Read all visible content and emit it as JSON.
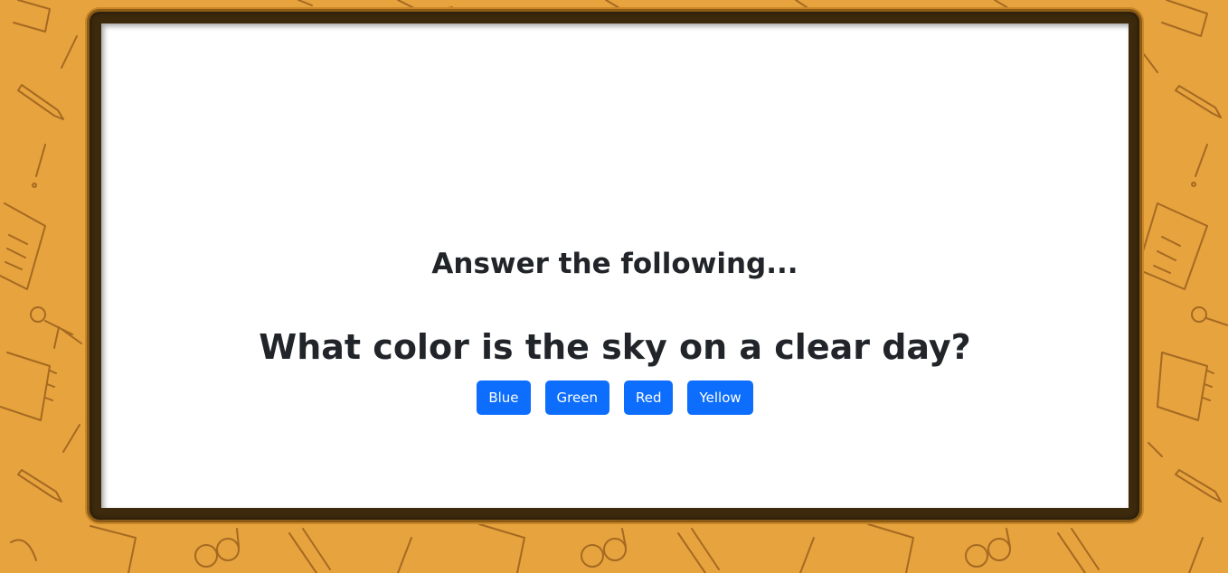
{
  "quiz": {
    "heading": "Answer the following...",
    "question": "What color is the sky on a clear day?",
    "answers": [
      "Blue",
      "Green",
      "Red",
      "Yellow"
    ]
  },
  "colors": {
    "background": "#e6a33e",
    "frame": "#3d2a0d",
    "board": "#ffffff",
    "button": "#0d6efd",
    "text": "#212529"
  },
  "icons": [
    "notebook-icon",
    "pencil-icon",
    "exclamation-icon",
    "paper-icon",
    "stick-figure-icon",
    "glasses-icon"
  ]
}
